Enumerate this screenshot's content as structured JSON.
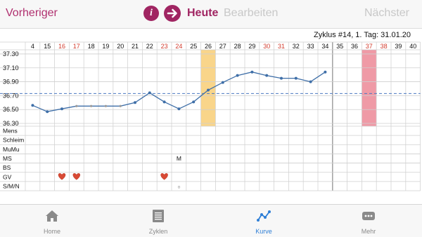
{
  "nav": {
    "prev_label": "Vorheriger",
    "info_icon_glyph": "i",
    "today_label": "Heute",
    "edit_label": "Bearbeiten",
    "next_label": "Nächster"
  },
  "cycle_info": "Zyklus #14, 1. Tag: 31.01.20",
  "chart_data": {
    "type": "line",
    "days": [
      "4",
      "15",
      "16",
      "17",
      "18",
      "19",
      "20",
      "21",
      "22",
      "23",
      "24",
      "25",
      "26",
      "27",
      "28",
      "29",
      "30",
      "31",
      "32",
      "33",
      "34",
      "35",
      "36",
      "37",
      "38",
      "39",
      "40"
    ],
    "highlight_red_days": [
      "16",
      "17",
      "23",
      "24",
      "30",
      "31",
      "37",
      "38"
    ],
    "temperatures": [
      36.56,
      36.47,
      36.51,
      36.55,
      36.55,
      36.55,
      36.55,
      36.6,
      36.74,
      36.61,
      36.51,
      36.61,
      36.78,
      36.89,
      36.99,
      37.04,
      36.99,
      36.95,
      36.95,
      36.9,
      37.04
    ],
    "temperature_unit": "°C",
    "y_ticks": [
      "37.30",
      "37.10",
      "36.90",
      "36.70",
      "36.50",
      "36.30"
    ],
    "ylim": [
      36.26,
      37.36
    ],
    "coverline": 36.73,
    "ovulation_day": "26",
    "menstruation_day": "37",
    "colors": {
      "line": "#3f6fa8",
      "coverline": "#4a78c0",
      "ovulation": "#f9d58a",
      "menstruation": "#ef9aa6",
      "red_day": "#d23c2e"
    },
    "row_labels": [
      "Mens",
      "Schleim",
      "MuMu",
      "MS",
      "BS",
      "GV",
      "S/M/N"
    ],
    "row_markers": [
      {
        "row": "MS",
        "day": "24",
        "text": "M"
      },
      {
        "row": "GV",
        "day": "16",
        "icon": "heart-icon"
      },
      {
        "row": "GV",
        "day": "17",
        "icon": "heart-icon"
      },
      {
        "row": "GV",
        "day": "23",
        "icon": "heart-icon"
      },
      {
        "row": "S/M/N",
        "day": "24",
        "text": "o"
      }
    ]
  },
  "tabs": [
    {
      "label": "Home",
      "icon": "home-icon",
      "active": false
    },
    {
      "label": "Zyklen",
      "icon": "list-icon",
      "active": false
    },
    {
      "label": "Kurve",
      "icon": "curve-icon",
      "active": true
    },
    {
      "label": "Mehr",
      "icon": "more-icon",
      "active": false
    }
  ]
}
